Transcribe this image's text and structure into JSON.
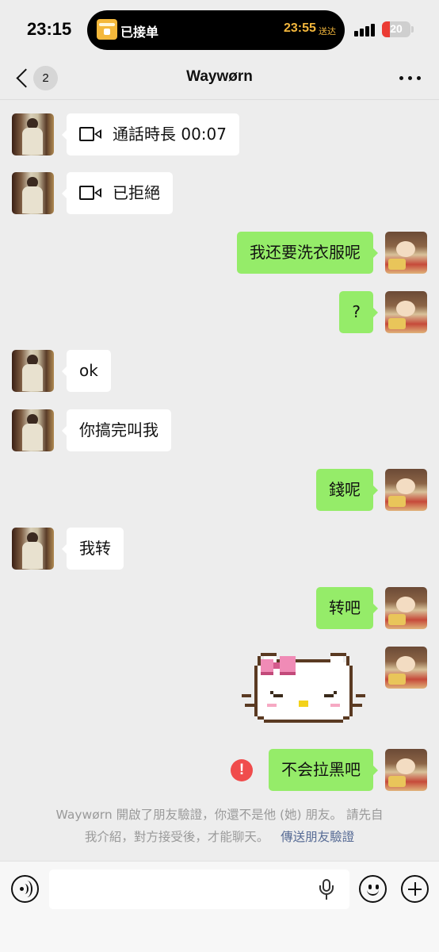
{
  "status_bar": {
    "time": "23:15",
    "live_activity": {
      "label": "已接单",
      "eta": "23:55",
      "eta_suffix": "送达"
    },
    "battery_level": "20",
    "battery_color": "#eb3b33"
  },
  "nav": {
    "unread_count": "2",
    "title": "Waywørn"
  },
  "messages": [
    {
      "side": "left",
      "type": "call",
      "icon": "video-call-icon",
      "text": "通話時長 00:07"
    },
    {
      "side": "left",
      "type": "call",
      "icon": "video-call-icon",
      "text": "已拒絕"
    },
    {
      "side": "right",
      "type": "text",
      "text": "我还要洗衣服呢"
    },
    {
      "side": "right",
      "type": "text",
      "text": "?"
    },
    {
      "side": "left",
      "type": "text",
      "text": "ok"
    },
    {
      "side": "left",
      "type": "text",
      "text": "你搞完叫我"
    },
    {
      "side": "right",
      "type": "text",
      "text": "錢呢"
    },
    {
      "side": "left",
      "type": "text",
      "text": "我转"
    },
    {
      "side": "right",
      "type": "text",
      "text": "转吧"
    },
    {
      "side": "right",
      "type": "sticker",
      "sticker": "hello-kitty-pixel"
    },
    {
      "side": "right",
      "type": "text",
      "text": "不会拉黑吧",
      "failed": true,
      "error_icon": "!"
    }
  ],
  "system_notice": {
    "line1": "Waywørn 開啟了朋友驗證，你還不是他 (她) 朋友。 請先自",
    "line2": "我介紹，對方接受後，才能聊天。",
    "link": "傳送朋友驗證"
  },
  "input_bar": {
    "placeholder": "",
    "icons": [
      "voice-icon",
      "mic-icon",
      "emoji-icon",
      "plus-icon"
    ]
  },
  "colors": {
    "background": "#ededed",
    "bubble_self": "#95ec69",
    "bubble_other": "#ffffff",
    "link": "#576b95",
    "error": "#f04c4c"
  }
}
